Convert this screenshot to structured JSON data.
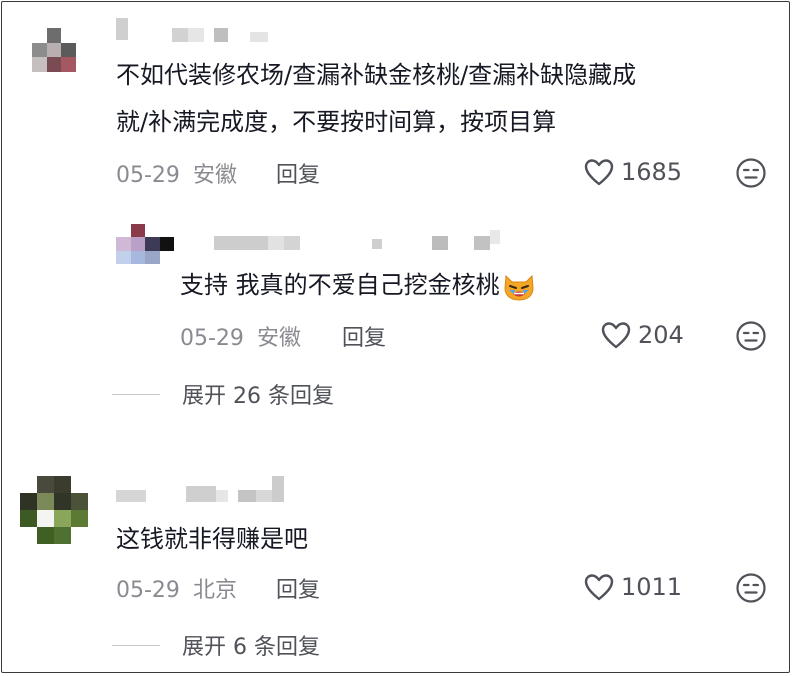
{
  "comments": [
    {
      "text_lines": [
        "不如代装修农场/查漏补缺金核桃/查漏补缺隐藏成",
        "就/补满完成度，不要按时间算，按项目算"
      ],
      "date": "05-29",
      "location": "安徽",
      "reply_label": "回复",
      "likes": "1685",
      "replies": [
        {
          "text": "支持 我真的不爱自己挖金核桃",
          "emoji_icon": "crying-cat-emoji",
          "date": "05-29",
          "location": "安徽",
          "reply_label": "回复",
          "likes": "204"
        }
      ],
      "expand_label": "展开 26 条回复"
    },
    {
      "text_lines": [
        "这钱就非得赚是吧"
      ],
      "date": "05-29",
      "location": "北京",
      "reply_label": "回复",
      "likes": "1011",
      "replies": [],
      "expand_label": "展开 6 条回复"
    }
  ],
  "icons": {
    "like": "heart-outline-icon",
    "dislike": "meh-face-icon"
  },
  "colors": {
    "text": "#161823",
    "meta": "#8a8b91",
    "action": "#505259",
    "pixelation": "#d8d8d8"
  }
}
